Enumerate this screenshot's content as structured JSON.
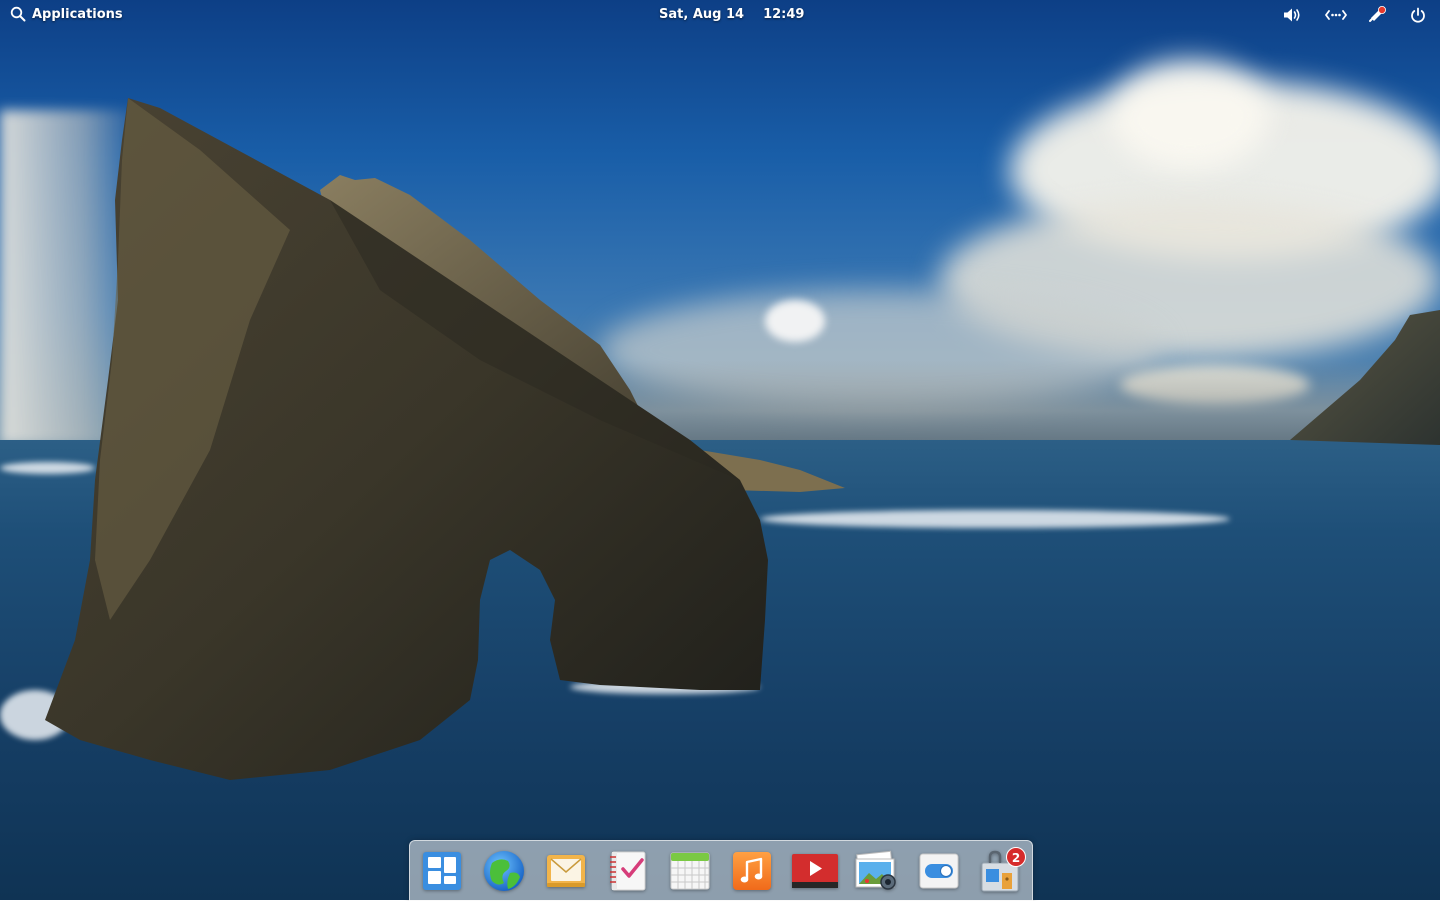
{
  "top_panel": {
    "applications_label": "Applications",
    "date": "Sat, Aug 14",
    "time": "12:49",
    "indicators": [
      {
        "name": "volume-icon"
      },
      {
        "name": "network-icon"
      },
      {
        "name": "notifications-icon",
        "has_unread": true
      },
      {
        "name": "power-icon"
      }
    ]
  },
  "dock": {
    "apps": [
      {
        "name": "multitasking-view",
        "icon": "multitasking-icon"
      },
      {
        "name": "web-browser",
        "icon": "globe-icon"
      },
      {
        "name": "mail",
        "icon": "mail-icon"
      },
      {
        "name": "tasks",
        "icon": "tasks-icon"
      },
      {
        "name": "calendar",
        "icon": "calendar-icon"
      },
      {
        "name": "music",
        "icon": "music-icon"
      },
      {
        "name": "videos",
        "icon": "video-icon"
      },
      {
        "name": "photos",
        "icon": "photos-icon"
      },
      {
        "name": "system-settings",
        "icon": "settings-toggle-icon"
      },
      {
        "name": "appcenter",
        "icon": "appcenter-icon",
        "badge": "2"
      }
    ]
  },
  "colors": {
    "badge": "#d62b2b",
    "notification_dot": "#e5392d"
  }
}
